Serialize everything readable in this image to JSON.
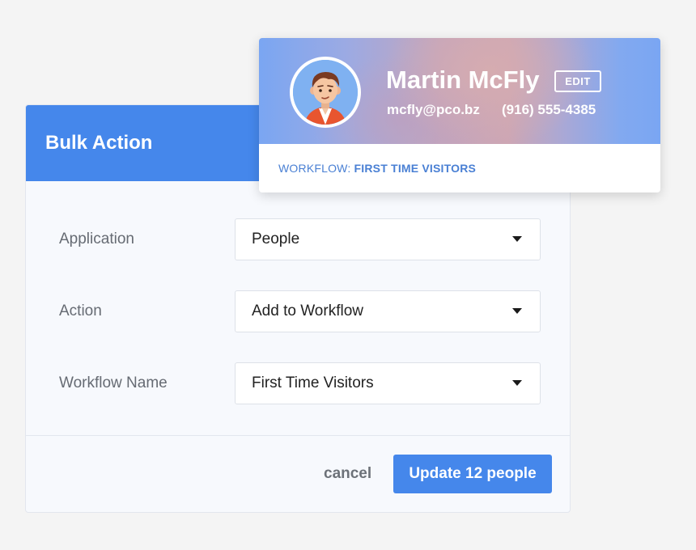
{
  "bulk_action": {
    "title": "Bulk Action",
    "fields": [
      {
        "label": "Application",
        "value": "People"
      },
      {
        "label": "Action",
        "value": "Add to Workflow"
      },
      {
        "label": "Workflow Name",
        "value": "First Time Visitors"
      }
    ],
    "cancel_label": "cancel",
    "submit_label": "Update 12 people"
  },
  "profile_card": {
    "name": "Martin McFly",
    "edit_label": "EDIT",
    "email": "mcfly@pco.bz",
    "phone": "(916) 555-4385",
    "workflow_prefix": "WORKFLOW:",
    "workflow_name": "FIRST TIME VISITORS"
  },
  "colors": {
    "accent": "#4587eb",
    "panel_background": "#f7f9fd",
    "link": "#4a80d4"
  },
  "icons": {
    "dropdown": "caret-down-icon",
    "avatar": "person-avatar"
  }
}
